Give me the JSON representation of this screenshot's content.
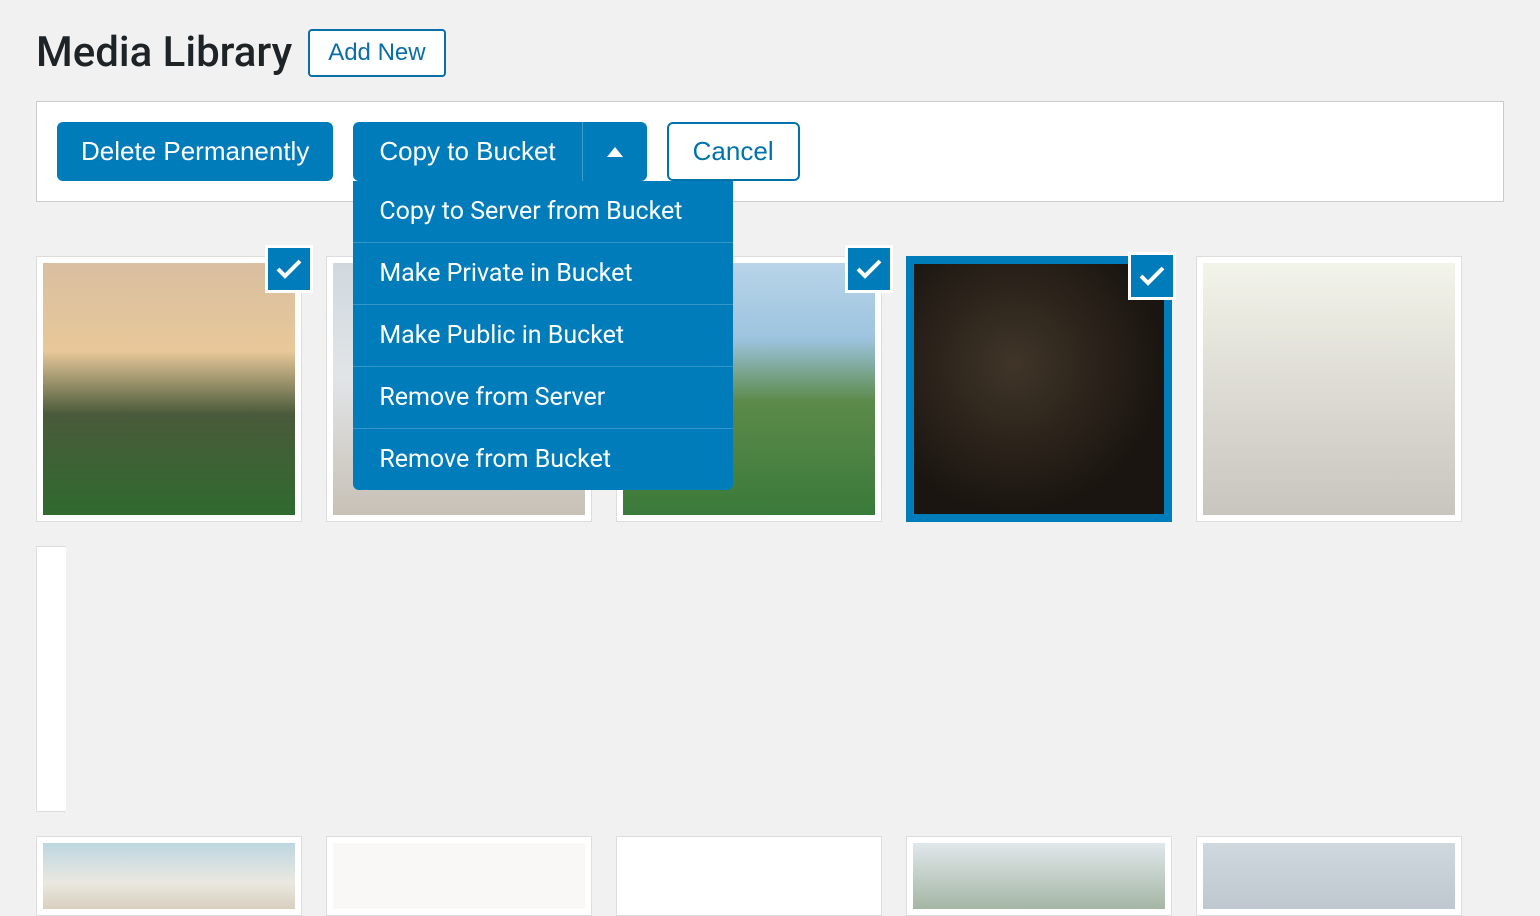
{
  "header": {
    "page_title": "Media Library",
    "add_new_label": "Add New"
  },
  "toolbar": {
    "delete_label": "Delete Permanently",
    "dropdown_label": "Copy to Bucket",
    "cancel_label": "Cancel",
    "dropdown_items": [
      "Copy to Server from Bucket",
      "Make Private in Bucket",
      "Make Public in Bucket",
      "Remove from Server",
      "Remove from Bucket"
    ]
  },
  "media": {
    "items": [
      {
        "selected": true
      },
      {
        "selected": false
      },
      {
        "selected": true
      },
      {
        "selected": true
      },
      {
        "selected": false
      },
      {
        "selected": false
      }
    ]
  }
}
